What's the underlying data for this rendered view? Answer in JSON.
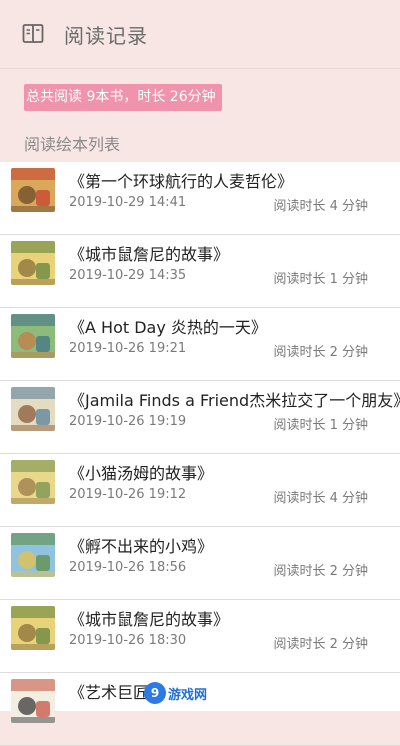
{
  "header": {
    "title": "阅读记录",
    "icon": "book-icon"
  },
  "summary": {
    "text": "总共阅读 9本书，时长 26分钟"
  },
  "section": {
    "label": "阅读绘本列表"
  },
  "books": [
    {
      "title": "《第一个环球航行的人麦哲伦》",
      "date": "2019-10-29 14:41",
      "duration": "阅读时长 4 分钟",
      "cover_colors": [
        "#d9a85b",
        "#6a4a2a",
        "#c43b2c"
      ]
    },
    {
      "title": "《城市鼠詹尼的故事》",
      "date": "2019-10-29 14:35",
      "duration": "阅读时长 1 分钟",
      "cover_colors": [
        "#e8d27a",
        "#8a6f3c",
        "#5a7d3a"
      ]
    },
    {
      "title": "《A Hot Day  炎热的一天》",
      "date": "2019-10-26 19:21",
      "duration": "阅读时长 2 分钟",
      "cover_colors": [
        "#8dbb7a",
        "#c47d4a",
        "#3f6e8c"
      ]
    },
    {
      "title": "《Jamila Finds a Friend杰米拉交了一个朋友》",
      "date": "2019-10-26 19:19",
      "duration": "阅读时长 1 分钟",
      "cover_colors": [
        "#e4dcc0",
        "#8a5a3a",
        "#4f7a9a"
      ]
    },
    {
      "title": "《小猫汤姆的故事》",
      "date": "2019-10-26 19:12",
      "duration": "阅读时长 4 分钟",
      "cover_colors": [
        "#e9d78a",
        "#9a7b4a",
        "#6b8d4a"
      ]
    },
    {
      "title": "《孵不出来的小鸡》",
      "date": "2019-10-26 18:56",
      "duration": "阅读时长 2 分钟",
      "cover_colors": [
        "#8fc3e0",
        "#e6c24a",
        "#5a8a3a"
      ]
    },
    {
      "title": "《城市鼠詹尼的故事》",
      "date": "2019-10-26 18:30",
      "duration": "阅读时长 2 分钟",
      "cover_colors": [
        "#e8d27a",
        "#8a6f3c",
        "#5a7d3a"
      ]
    },
    {
      "title": "《艺术巨匠",
      "date": "",
      "duration": "",
      "cover_colors": [
        "#f2efe2",
        "#3a3a3a",
        "#c44a3a"
      ]
    }
  ],
  "watermark": {
    "logo": "9",
    "text": "游戏网"
  }
}
